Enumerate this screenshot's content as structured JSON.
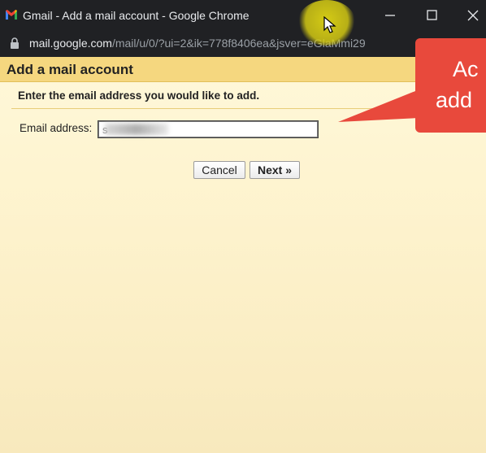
{
  "browser": {
    "window_title": "Gmail - Add a mail account - Google Chrome",
    "url_domain": "mail.google.com",
    "url_path": "/mail/u/0/?ui=2&ik=778f8406ea&jsver=eGlaMmi29",
    "icons": [
      "gmail-icon",
      "minimize-icon",
      "maximize-icon",
      "close-icon",
      "lock-icon",
      "cursor-icon"
    ]
  },
  "dialog": {
    "title": "Add a mail account",
    "instruction": "Enter the email address you would like to add.",
    "email_label": "Email address:",
    "email_value": "s",
    "cancel_label": "Cancel",
    "next_label": "Next »"
  },
  "callout": {
    "line1": "Ac",
    "line2": "add",
    "color": "#e8493c"
  },
  "colors": {
    "header_bg": "#f5d77f",
    "page_bg": "#fff8d9",
    "chrome_bg": "#202124"
  }
}
